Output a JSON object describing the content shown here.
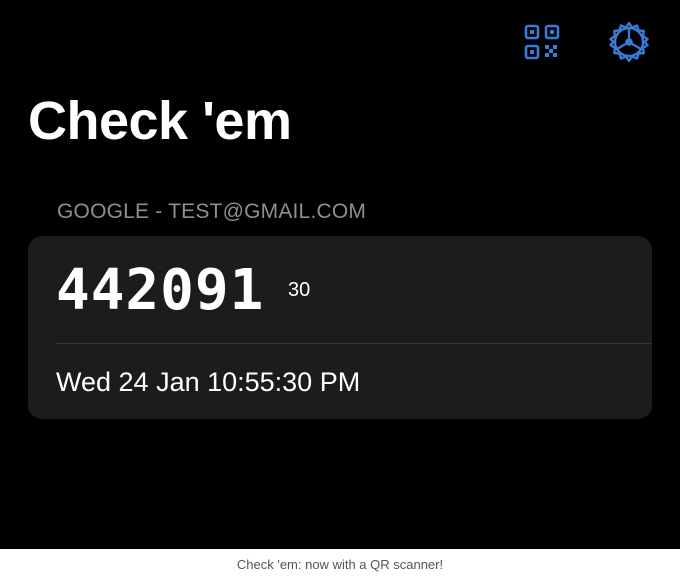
{
  "header": {
    "title": "Check 'em",
    "qr_icon": "qr-code-icon",
    "settings_icon": "gear-icon",
    "accent_color": "#3a7bd5"
  },
  "account": {
    "label": "GOOGLE - TEST@GMAIL.COM",
    "code": "442091",
    "countdown": "30",
    "timestamp": "Wed 24 Jan 10:55:30 PM"
  },
  "footer": {
    "text": "Check 'em: now with a QR scanner!"
  }
}
